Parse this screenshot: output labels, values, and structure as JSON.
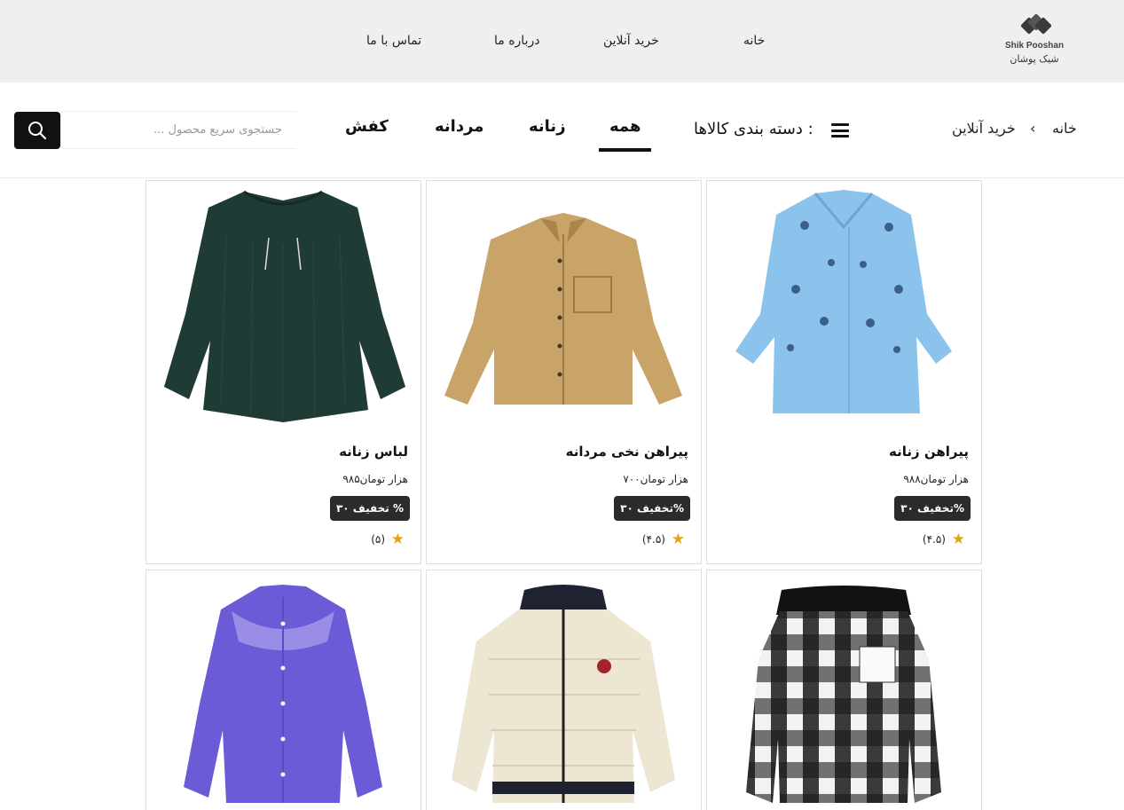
{
  "brand": {
    "name_en": "Shik Pooshan",
    "name_fa": "شیک پوشان"
  },
  "nav": {
    "home": "خانه",
    "shop": "خرید آنلاین",
    "about": "درباره ما",
    "contact": "تماس با ما"
  },
  "breadcrumb": {
    "home": "خانه",
    "separator": "‹",
    "current": "خرید آنلاین"
  },
  "categories": {
    "label": "دسته بندی کالاها :",
    "tabs": [
      "همه",
      "زنانه",
      "مردانه",
      "کفش"
    ],
    "active": "همه"
  },
  "search": {
    "placeholder": "جستجوی سریع محصول ...",
    "value": ""
  },
  "products": [
    {
      "title": "پیراهن زنانه",
      "price": "۹۸۸هزار تومان",
      "discount": "تخفیف ۳۰%",
      "rating": "(۴.۵)",
      "image": "light-blue-embroidered-blouse"
    },
    {
      "title": "پیراهن نخی مردانه",
      "price": "۷۰۰هزار تومان",
      "discount": "تخفیف ۳۰%",
      "rating": "(۴.۵)",
      "image": "tan-corduroy-shirt"
    },
    {
      "title": "لباس زنانه",
      "price": "۹۸۵هزار تومان",
      "discount": "تخفیف ۳۰ %",
      "rating": "(۵)",
      "image": "dark-green-pleated-blouse"
    },
    {
      "image": "black-white-plaid-hooded-shirt"
    },
    {
      "image": "cream-puffer-jacket"
    },
    {
      "image": "purple-lace-yoke-blouse"
    }
  ],
  "colors": {
    "topbar": "#f0efef",
    "star": "#e5a50a",
    "badge": "#2b2b2b",
    "button": "#111111"
  }
}
